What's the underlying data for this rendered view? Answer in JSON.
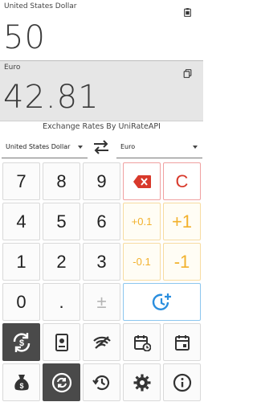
{
  "source": {
    "currency": "United States Dollar",
    "value": "50"
  },
  "target": {
    "currency": "Euro",
    "value": "42.81"
  },
  "rates_title": "Exchange Rates By UniRateAPI",
  "selectors": {
    "from": "United States Dollar",
    "to": "Euro"
  },
  "keys": {
    "seven": "7",
    "eight": "8",
    "nine": "9",
    "clear": "C",
    "four": "4",
    "five": "5",
    "six": "6",
    "plus_point_one": "+0.1",
    "plus_one": "+1",
    "one": "1",
    "two": "2",
    "three": "3",
    "minus_point_one": "-0.1",
    "minus_one": "-1",
    "zero": "0",
    "dot": ".",
    "plus_minus": "±"
  },
  "colors": {
    "red": "#d8392b",
    "amber": "#f2b12c",
    "blue": "#2a8ede",
    "dark": "#4a4a4a",
    "target_bg": "#e6e6e6"
  },
  "icons": {
    "backspace": "backspace-icon",
    "history_add": "clock-plus-icon",
    "convert": "convert-icon",
    "passport": "passport-icon",
    "signal": "signal-icon",
    "calendar_clock": "calendar-clock-icon",
    "calendar": "calendar-icon",
    "money_bag": "money-bag-icon",
    "sync": "sync-icon",
    "history": "history-icon",
    "settings": "gear-icon",
    "info": "info-icon"
  }
}
